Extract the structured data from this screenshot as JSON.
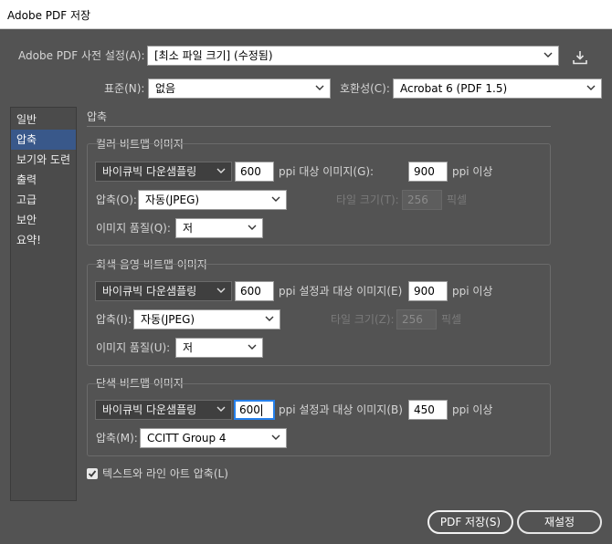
{
  "window": {
    "title": "Adobe PDF 저장"
  },
  "preset": {
    "label": "Adobe PDF 사전 설정(A):",
    "value": "[최소 파일 크기] (수정됨)",
    "save_icon": "download-icon"
  },
  "standard": {
    "label": "표준(N):",
    "value": "없음"
  },
  "compat": {
    "label": "호환성(C):",
    "value": "Acrobat 6 (PDF 1.5)"
  },
  "sidebar": {
    "items": [
      {
        "label": "일반"
      },
      {
        "label": "압축"
      },
      {
        "label": "보기와 도련"
      },
      {
        "label": "출력"
      },
      {
        "label": "고급"
      },
      {
        "label": "보안"
      },
      {
        "label": "요약!"
      }
    ],
    "active_index": 1
  },
  "section": {
    "title": "압축"
  },
  "color": {
    "title": "컬러 비트맵 이미지",
    "sampling": "바이큐빅 다운샘플링",
    "ppi": "600",
    "ppi_text": "ppi 대상 이미지(G):",
    "above": "900",
    "above_text": "ppi 이상",
    "compression_label": "압축(O):",
    "compression": "자동(JPEG)",
    "tile_label": "타일 크기(T):",
    "tile": "256",
    "tile_unit": "픽셀",
    "quality_label": "이미지 품질(Q):",
    "quality": "저"
  },
  "gray": {
    "title": "회색 음영 비트맵 이미지",
    "sampling": "바이큐빅 다운샘플링",
    "ppi": "600",
    "ppi_text": "ppi 설정과 대상 이미지(E)",
    "above": "900",
    "above_text": "ppi 이상",
    "compression_label": "압축(I):",
    "compression": "자동(JPEG)",
    "tile_label": "타일 크기(Z):",
    "tile": "256",
    "tile_unit": "픽셀",
    "quality_label": "이미지 품질(U):",
    "quality": "저"
  },
  "mono": {
    "title": "단색 비트맵 이미지",
    "sampling": "바이큐빅 다운샘플링",
    "ppi": "600",
    "ppi_text": "ppi 설정과 대상 이미지(B)",
    "above": "450",
    "above_text": "ppi 이상",
    "compression_label": "압축(M):",
    "compression": "CCITT Group 4"
  },
  "textart": {
    "label": "텍스트와 라인 아트 압축(L)",
    "checked": true
  },
  "buttons": {
    "save": "PDF 저장(S)",
    "reset": "재설정"
  }
}
